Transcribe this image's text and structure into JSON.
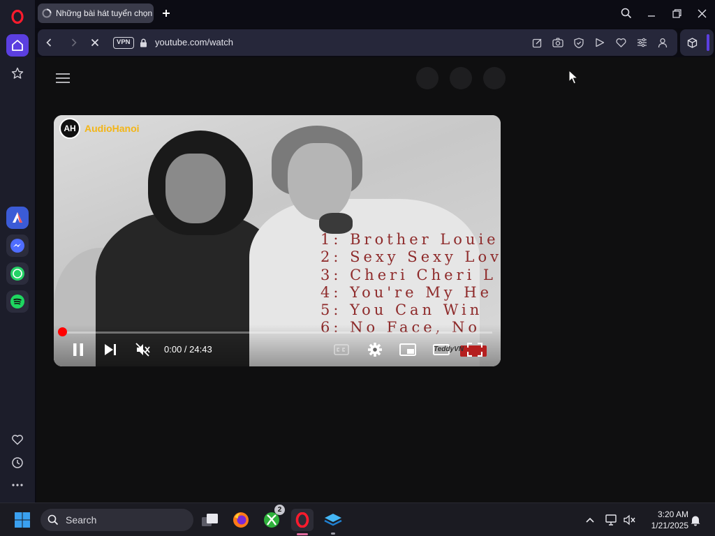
{
  "browser": {
    "tab": {
      "title": "Những bài hát tuyển chọn"
    },
    "address": {
      "vpn_label": "VPN",
      "url": "youtube.com/watch"
    }
  },
  "video": {
    "channel_brand": "AudioHanoi",
    "brand_logo_text": "AH",
    "tracklist": [
      "1: Brother Louie",
      "2: Sexy Sexy Lov",
      "3: Cheri Cheri L",
      "4: You're My He",
      "5: You Can Win",
      "6: No Face, No"
    ],
    "time_current": "0:00",
    "time_total": "24:43",
    "progress_fraction": 0.0,
    "overlay_badge": "TeddyVN"
  },
  "taskbar": {
    "search_label": "Search",
    "xbox_badge": "2",
    "clock_time": "3:20 AM",
    "clock_date": "1/21/2025"
  },
  "colors": {
    "opera_red": "#ff1b2d",
    "sidebar_active": "#5b3fe0",
    "youtube_red": "#ff0000",
    "brand_yellow": "#f3b516",
    "track_text": "#8e2a2a"
  }
}
